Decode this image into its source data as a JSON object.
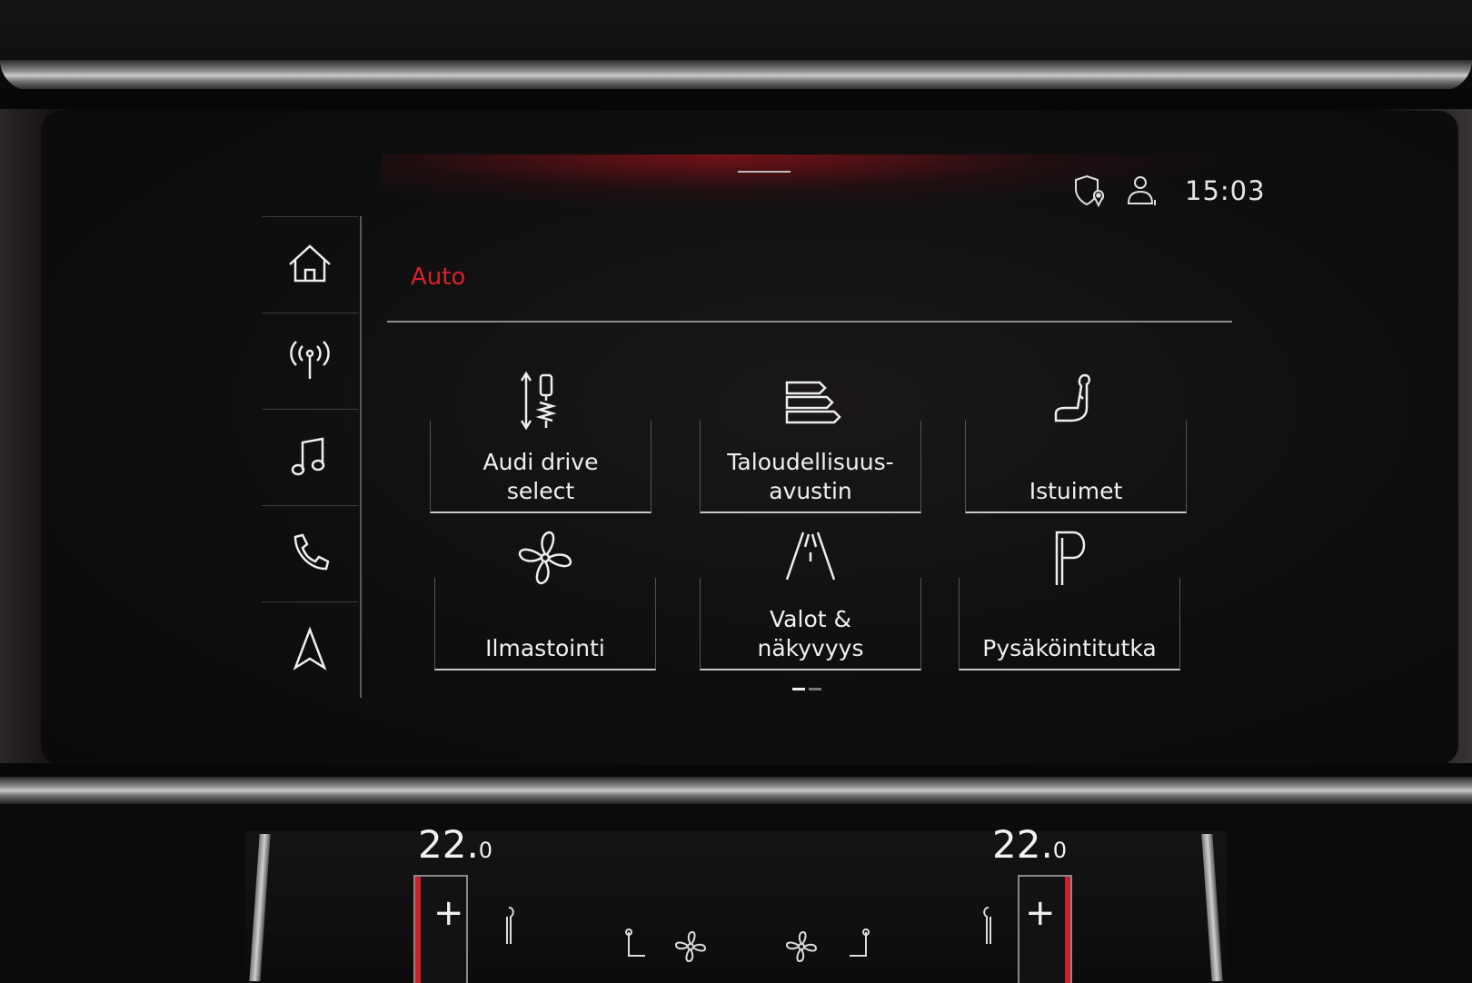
{
  "header": {
    "time": "15:03",
    "icons": [
      "privacy-location-icon",
      "user-profile-icon"
    ]
  },
  "sidebar": {
    "items": [
      {
        "name": "home",
        "icon": "home-icon"
      },
      {
        "name": "radio",
        "icon": "radio-antenna-icon"
      },
      {
        "name": "media",
        "icon": "music-note-icon"
      },
      {
        "name": "phone",
        "icon": "phone-icon"
      },
      {
        "name": "navigation",
        "icon": "navigation-arrow-icon"
      }
    ]
  },
  "main": {
    "title": "Auto",
    "tiles": [
      {
        "label": "Audi drive\nselect",
        "icon": "suspension-icon"
      },
      {
        "label": "Taloudellisuus-\navustin",
        "icon": "efficiency-bars-icon"
      },
      {
        "label": "Istuimet",
        "icon": "seat-icon"
      },
      {
        "label": "Ilmastointi",
        "icon": "fan-icon"
      },
      {
        "label": "Valot &\nnäkyvyys",
        "icon": "road-lights-icon"
      },
      {
        "label": "Pysäköintitutka",
        "icon": "parking-icon"
      }
    ],
    "pager": {
      "pages": 2,
      "current": 1
    }
  },
  "climate": {
    "left_temp": "22.",
    "left_temp_decimal": "0",
    "right_temp": "22.",
    "right_temp_decimal": "0",
    "plus_label": "+"
  },
  "colors": {
    "accent_red": "#d9202d",
    "text": "#f0f0f0",
    "background": "#0f0e0f"
  }
}
